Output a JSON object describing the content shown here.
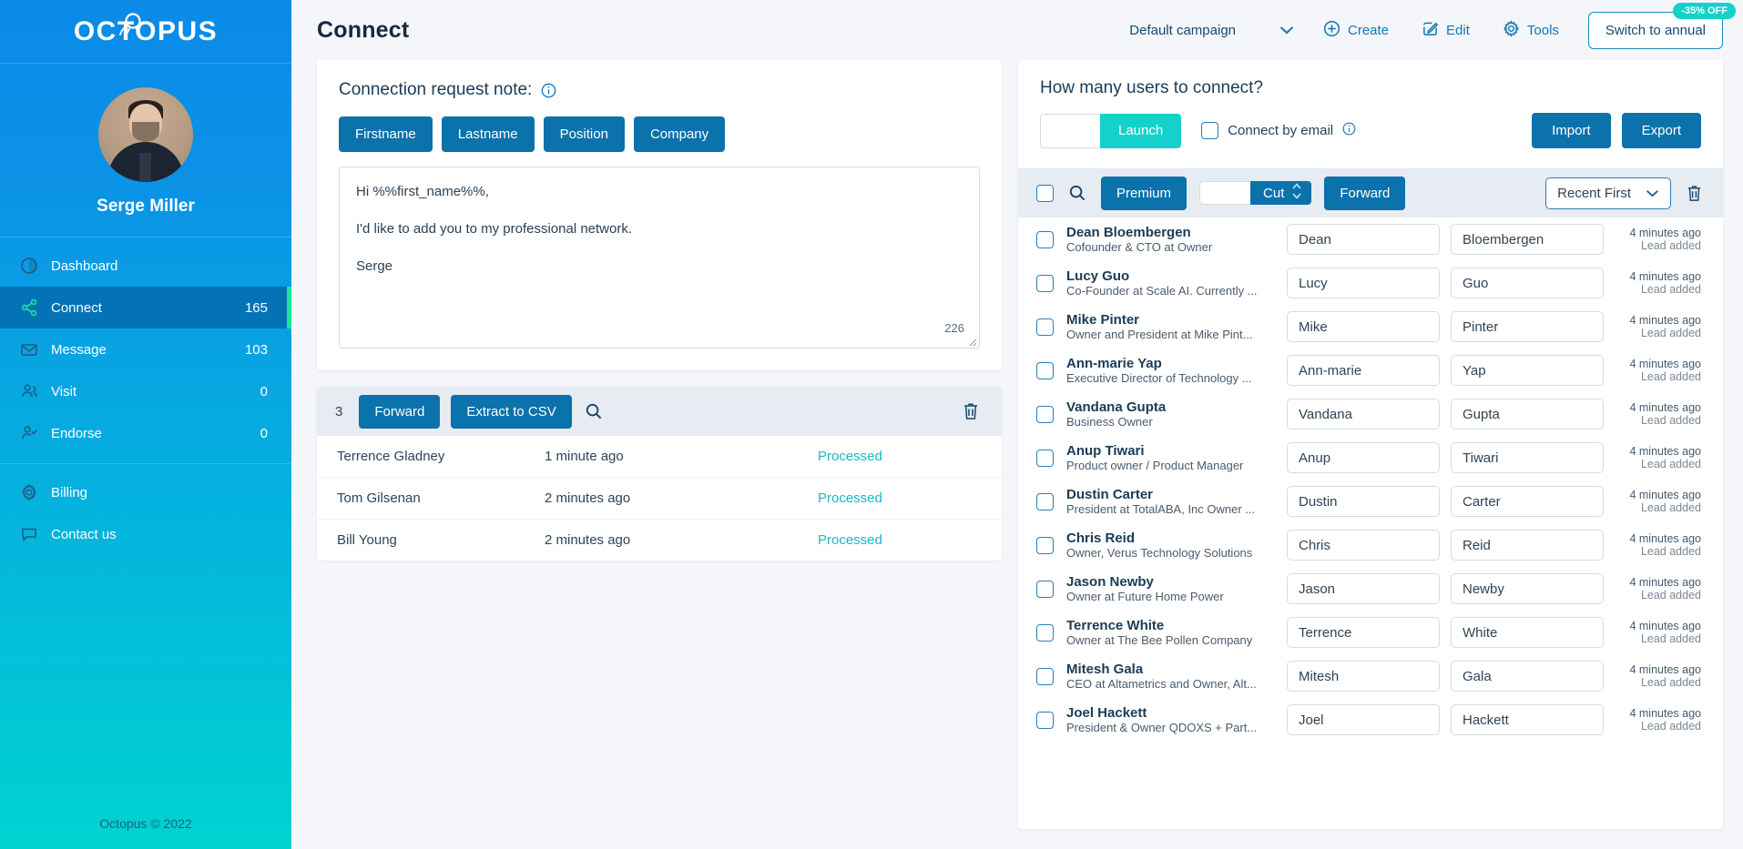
{
  "brand": {
    "logo_text_part1": "OC",
    "logo_text_part2": "T",
    "logo_text_part3": "OPUS",
    "footer": "Octopus © 2022"
  },
  "profile": {
    "name": "Serge Miller"
  },
  "sidebar": {
    "items": [
      {
        "label": "Dashboard",
        "count": "",
        "icon": "dashboard-icon",
        "active": false
      },
      {
        "label": "Connect",
        "count": "165",
        "icon": "share-icon",
        "active": true
      },
      {
        "label": "Message",
        "count": "103",
        "icon": "envelope-icon",
        "active": false
      },
      {
        "label": "Visit",
        "count": "0",
        "icon": "users-icon",
        "active": false
      },
      {
        "label": "Endorse",
        "count": "0",
        "icon": "user-check-icon",
        "active": false
      }
    ],
    "secondary": [
      {
        "label": "Billing",
        "icon": "gear-icon"
      },
      {
        "label": "Contact us",
        "icon": "chat-icon"
      }
    ]
  },
  "topbar": {
    "page_title": "Connect",
    "campaign": "Default campaign",
    "create_label": "Create",
    "edit_label": "Edit",
    "tools_label": "Tools",
    "switch_label": "Switch to annual",
    "discount_badge": "-35% OFF"
  },
  "note": {
    "heading": "Connection request note:",
    "tags": [
      "Firstname",
      "Lastname",
      "Position",
      "Company"
    ],
    "lines": [
      "Hi %%first_name%%,",
      "I'd like to add you to my professional network.",
      "Serge"
    ],
    "char_count": "226"
  },
  "processed": {
    "count": "3",
    "forward_label": "Forward",
    "extract_label": "Extract to CSV",
    "rows": [
      {
        "name": "Terrence Gladney",
        "time": "1 minute ago",
        "status": "Processed"
      },
      {
        "name": "Tom Gilsenan",
        "time": "2 minutes ago",
        "status": "Processed"
      },
      {
        "name": "Bill Young",
        "time": "2 minutes ago",
        "status": "Processed"
      }
    ]
  },
  "connect_panel": {
    "title": "How many users to connect?",
    "count_value": "",
    "launch_label": "Launch",
    "connect_by_email_label": "Connect by email",
    "import_label": "Import",
    "export_label": "Export",
    "toolbar": {
      "premium_label": "Premium",
      "cut_value": "",
      "cut_label": "Cut",
      "forward_label": "Forward",
      "sort_label": "Recent First"
    },
    "users": [
      {
        "name": "Dean Bloembergen",
        "headline": "Cofounder & CTO at Owner",
        "first": "Dean",
        "last": "Bloembergen",
        "time": "4 minutes ago",
        "sub": "Lead added"
      },
      {
        "name": "Lucy Guo",
        "headline": "Co-Founder at Scale AI. Currently ...",
        "first": "Lucy",
        "last": "Guo",
        "time": "4 minutes ago",
        "sub": "Lead added"
      },
      {
        "name": "Mike Pinter",
        "headline": "Owner and President at Mike Pint...",
        "first": "Mike",
        "last": "Pinter",
        "time": "4 minutes ago",
        "sub": "Lead added"
      },
      {
        "name": "Ann-marie Yap",
        "headline": "Executive Director of Technology ...",
        "first": "Ann-marie",
        "last": "Yap",
        "time": "4 minutes ago",
        "sub": "Lead added"
      },
      {
        "name": "Vandana Gupta",
        "headline": "Business Owner",
        "first": "Vandana",
        "last": "Gupta",
        "time": "4 minutes ago",
        "sub": "Lead added"
      },
      {
        "name": "Anup Tiwari",
        "headline": "Product owner / Product Manager",
        "first": "Anup",
        "last": "Tiwari",
        "time": "4 minutes ago",
        "sub": "Lead added"
      },
      {
        "name": "Dustin Carter",
        "headline": "President at TotalABA, Inc Owner ...",
        "first": "Dustin",
        "last": "Carter",
        "time": "4 minutes ago",
        "sub": "Lead added"
      },
      {
        "name": "Chris Reid",
        "headline": "Owner, Verus Technology Solutions",
        "first": "Chris",
        "last": "Reid",
        "time": "4 minutes ago",
        "sub": "Lead added"
      },
      {
        "name": "Jason Newby",
        "headline": "Owner at Future Home Power",
        "first": "Jason",
        "last": "Newby",
        "time": "4 minutes ago",
        "sub": "Lead added"
      },
      {
        "name": "Terrence White",
        "headline": "Owner at The Bee Pollen Company",
        "first": "Terrence",
        "last": "White",
        "time": "4 minutes ago",
        "sub": "Lead added"
      },
      {
        "name": "Mitesh Gala",
        "headline": "CEO at Altametrics and Owner, Alt...",
        "first": "Mitesh",
        "last": "Gala",
        "time": "4 minutes ago",
        "sub": "Lead added"
      },
      {
        "name": "Joel Hackett",
        "headline": "President & Owner QDOXS + Part...",
        "first": "Joel",
        "last": "Hackett",
        "time": "4 minutes ago",
        "sub": "Lead added"
      }
    ]
  },
  "colors": {
    "brand_blue": "#0b72ab",
    "accent_teal": "#14d2cb",
    "active_nav": "#0472b5",
    "active_indicator": "#19e59b",
    "status_processed": "#1ab8c4"
  }
}
